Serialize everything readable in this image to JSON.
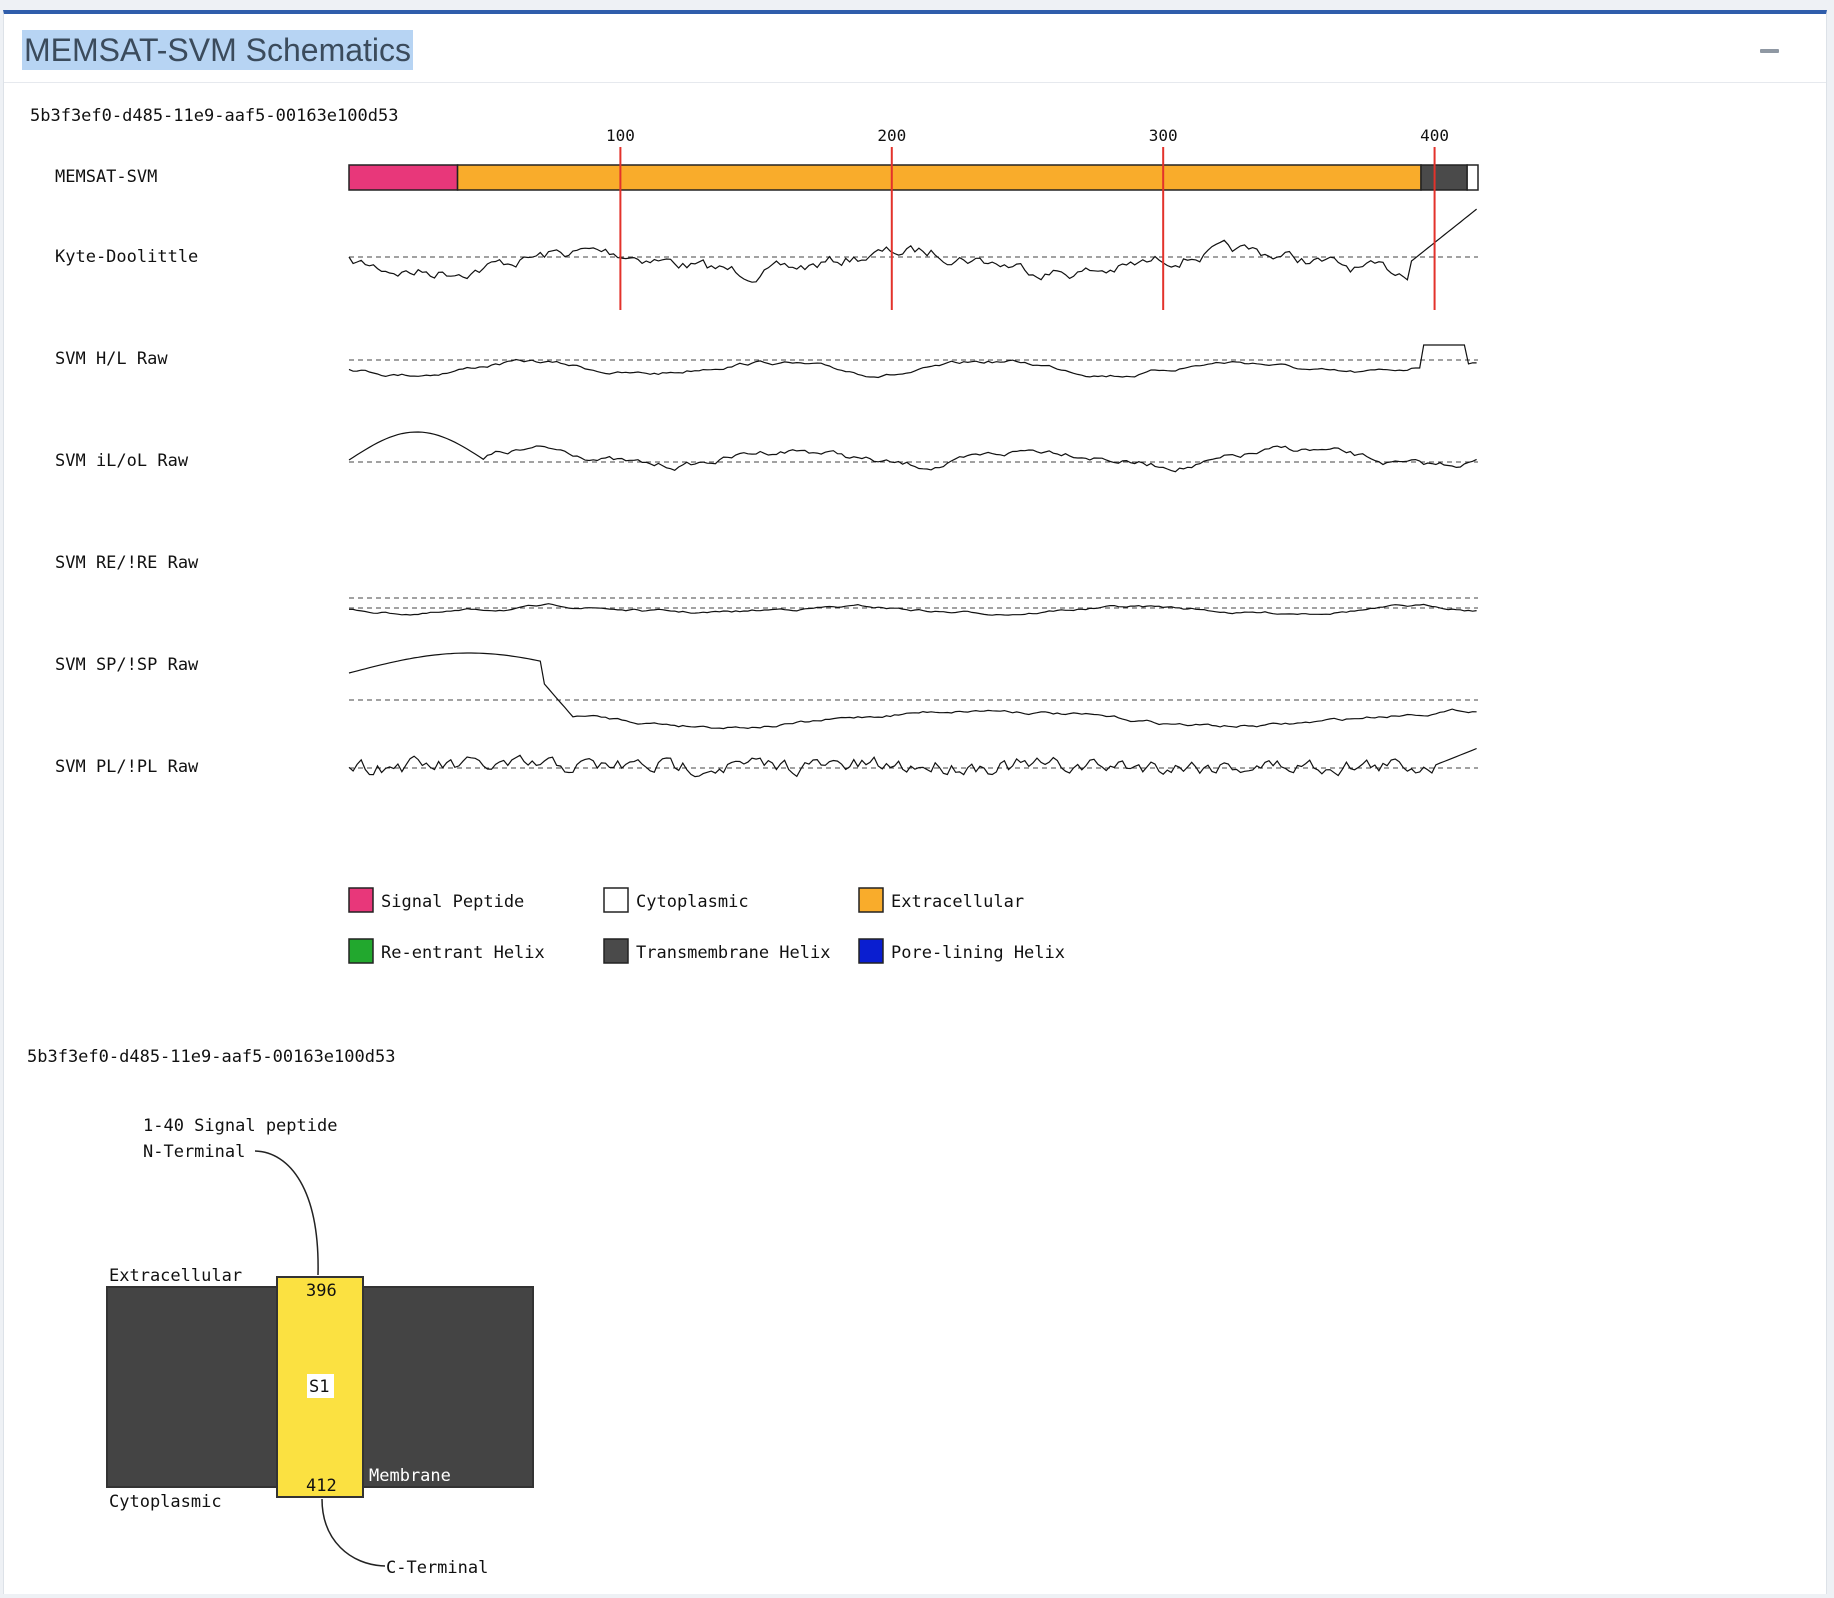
{
  "panel": {
    "title": "MEMSAT-SVM Schematics",
    "collapse_icon": "minus-icon"
  },
  "schematic": {
    "sequence_id": "5b3f3ef0-d485-11e9-aaf5-00163e100d53",
    "sequence_length": 416,
    "axis_ticks": [
      "100",
      "200",
      "300",
      "400"
    ],
    "track_labels": [
      "MEMSAT-SVM",
      "Kyte-Doolittle",
      "SVM H/L Raw",
      "SVM iL/oL Raw",
      "SVM RE/!RE Raw",
      "SVM SP/!SP Raw",
      "SVM PL/!PL Raw"
    ],
    "segments": [
      {
        "start": 1,
        "end": 40,
        "type": "Signal Peptide"
      },
      {
        "start": 41,
        "end": 395,
        "type": "Extracellular"
      },
      {
        "start": 396,
        "end": 412,
        "type": "Transmembrane Helix"
      },
      {
        "start": 413,
        "end": 416,
        "type": "Cytoplasmic"
      }
    ],
    "legend": [
      {
        "label": "Signal Peptide",
        "color": "#e8377a"
      },
      {
        "label": "Cytoplasmic",
        "color": "#ffffff"
      },
      {
        "label": "Extracellular",
        "color": "#f9ac2b"
      },
      {
        "label": "Re-entrant Helix",
        "color": "#22a82e"
      },
      {
        "label": "Transmembrane Helix",
        "color": "#4a4a4a"
      },
      {
        "label": "Pore-lining Helix",
        "color": "#0a1ed0"
      }
    ]
  },
  "topology": {
    "sequence_id": "5b3f3ef0-d485-11e9-aaf5-00163e100d53",
    "signal_label": "1-40 Signal peptide",
    "n_terminal": "N-Terminal",
    "c_terminal": "C-Terminal",
    "extracellular": "Extracellular",
    "cytoplasmic": "Cytoplasmic",
    "membrane": "Membrane",
    "helix_start": "396",
    "helix_name": "S1",
    "helix_end": "412"
  }
}
